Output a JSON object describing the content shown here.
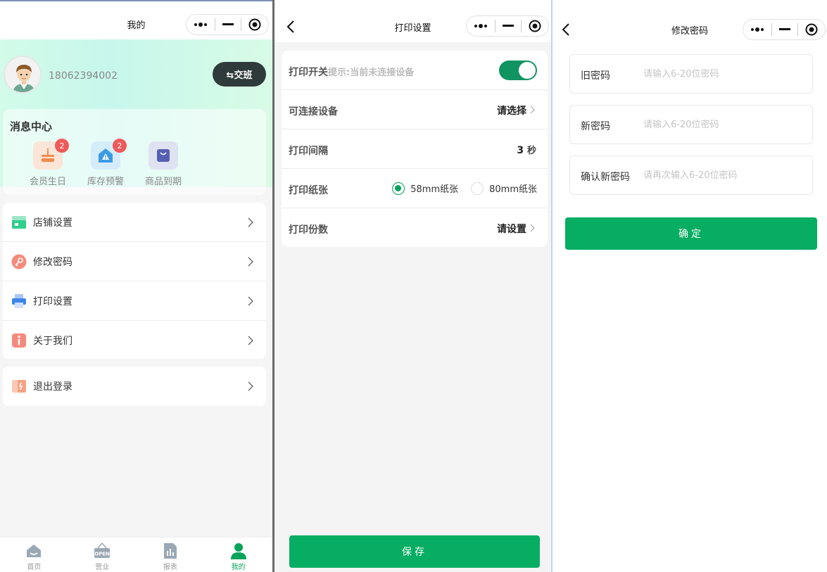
{
  "colors": {
    "accent": "#07ad62",
    "toggle_on": "#109461",
    "badge": "#ee5a5a",
    "shift_button": "#2f3b3b"
  },
  "mine": {
    "nav_title": "我的",
    "phone": "18062394002",
    "shift_button": "⇆交班",
    "message_center": {
      "title": "消息中心",
      "items": [
        {
          "label": "会员生日",
          "badge": "2",
          "icon": "birthday-cake-icon"
        },
        {
          "label": "库存预警",
          "badge": "2",
          "icon": "stock-warning-icon"
        },
        {
          "label": "商品到期",
          "badge": "",
          "icon": "shopping-bag-icon"
        }
      ]
    },
    "menu": [
      {
        "label": "店铺设置",
        "icon": "store-icon"
      },
      {
        "label": "修改密码",
        "icon": "key-icon"
      },
      {
        "label": "打印设置",
        "icon": "printer-icon"
      },
      {
        "label": "关于我们",
        "icon": "info-icon"
      }
    ],
    "logout": {
      "label": "退出登录",
      "icon": "logout-icon"
    },
    "tabs": [
      {
        "label": "首页",
        "icon": "home-icon"
      },
      {
        "label": "营业",
        "icon": "open-sign-icon"
      },
      {
        "label": "报表",
        "icon": "report-icon"
      },
      {
        "label": "我的",
        "icon": "user-icon",
        "active": true
      }
    ]
  },
  "print": {
    "nav_title": "打印设置",
    "switch_label": "打印开关",
    "switch_hint": "提示:当前未连接设备",
    "switch_on": true,
    "device_label": "可连接设备",
    "device_value": "请选择",
    "interval_label": "打印间隔",
    "interval_value": "3",
    "interval_unit": "秒",
    "paper_label": "打印纸张",
    "paper_options": [
      "58mm纸张",
      "80mm纸张"
    ],
    "paper_selected": "58mm纸张",
    "copies_label": "打印份数",
    "copies_value": "请设置",
    "save_button": "保存"
  },
  "password": {
    "nav_title": "修改密码",
    "fields": [
      {
        "label": "旧密码",
        "placeholder": "请输入6-20位密码",
        "value": ""
      },
      {
        "label": "新密码",
        "placeholder": "请输入6-20位密码",
        "value": ""
      },
      {
        "label": "确认新密码",
        "placeholder": "请再次输入6-20位密码",
        "value": ""
      }
    ],
    "confirm_button": "确定"
  }
}
